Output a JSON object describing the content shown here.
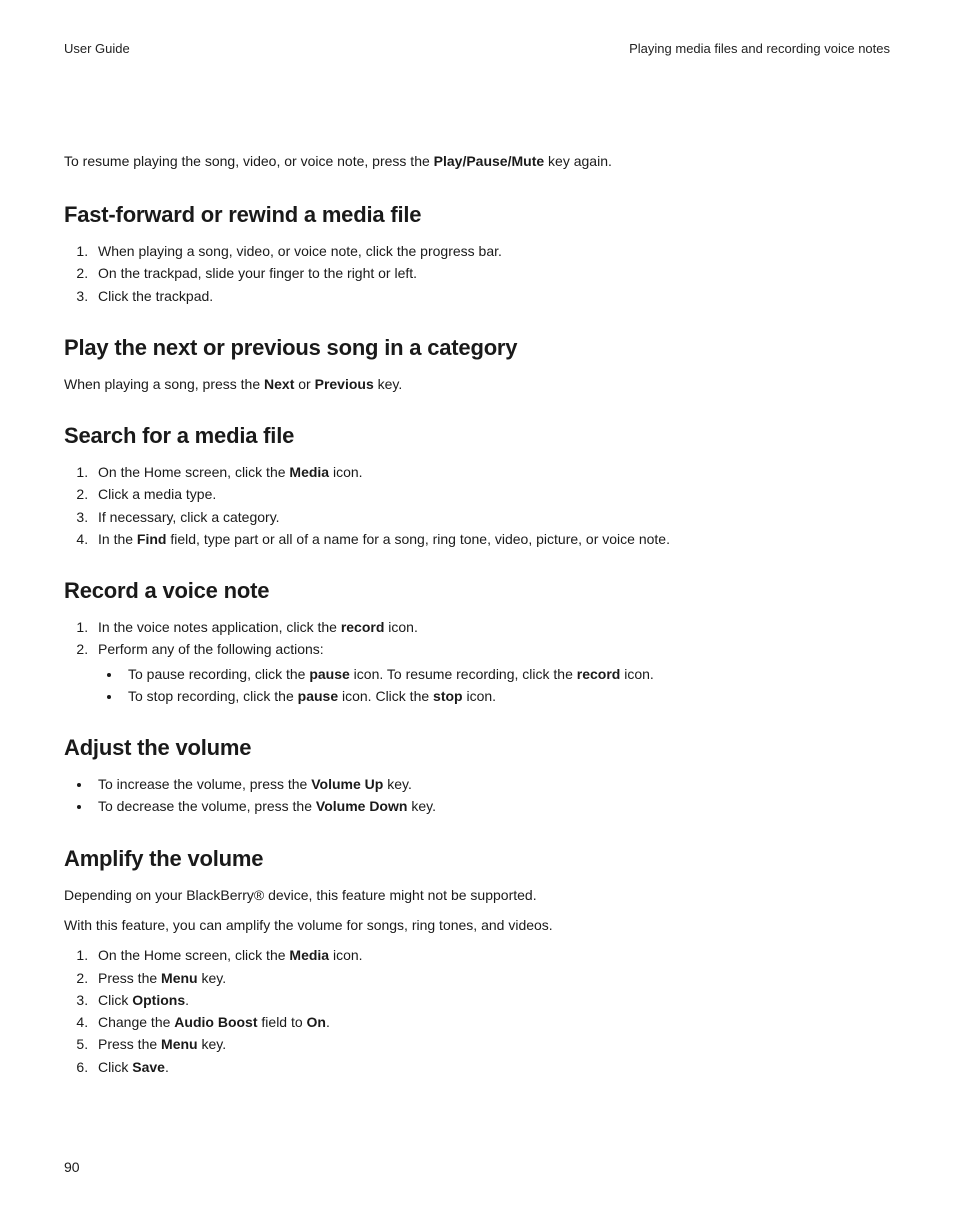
{
  "header": {
    "left": "User Guide",
    "right": "Playing media files and recording voice notes"
  },
  "intro": {
    "pre": "To resume playing the song, video, or voice note, press the ",
    "bold": "Play/Pause/Mute",
    "post": " key again."
  },
  "sec1": {
    "title": "Fast-forward or rewind a media file",
    "i1": "When playing a song, video, or voice note, click the progress bar.",
    "i2": "On the trackpad, slide your finger to the right or left.",
    "i3": "Click the trackpad."
  },
  "sec2": {
    "title": "Play the next or previous song in a category",
    "p_pre": "When playing a song, press the ",
    "b1": "Next",
    "p_mid": " or ",
    "b2": "Previous",
    "p_post": " key."
  },
  "sec3": {
    "title": "Search for a media file",
    "i1_pre": "On the Home screen, click the ",
    "i1_b": "Media",
    "i1_post": " icon.",
    "i2": "Click a media type.",
    "i3": "If necessary, click a category.",
    "i4_pre": "In the ",
    "i4_b": "Find",
    "i4_post": " field, type part or all of a name for a song, ring tone, video, picture, or voice note."
  },
  "sec4": {
    "title": "Record a voice note",
    "i1_pre": "In the voice notes application, click the ",
    "i1_b": "record",
    "i1_post": " icon.",
    "i2": "Perform any of the following actions:",
    "s1_pre": "To pause recording, click the ",
    "s1_b1": "pause",
    "s1_mid": " icon. To resume recording, click the ",
    "s1_b2": "record",
    "s1_post": " icon.",
    "s2_pre": "To stop recording, click the ",
    "s2_b1": "pause",
    "s2_mid": " icon. Click the ",
    "s2_b2": "stop",
    "s2_post": " icon."
  },
  "sec5": {
    "title": "Adjust the volume",
    "l1_pre": "To increase the volume, press the ",
    "l1_b": "Volume Up",
    "l1_post": " key.",
    "l2_pre": "To decrease the volume, press the ",
    "l2_b": "Volume Down",
    "l2_post": " key."
  },
  "sec6": {
    "title": "Amplify the volume",
    "p1": "Depending on your BlackBerry® device, this feature might not be supported.",
    "p2": "With this feature, you can amplify the volume for songs, ring tones, and videos.",
    "i1_pre": "On the Home screen, click the ",
    "i1_b": "Media",
    "i1_post": " icon.",
    "i2_pre": "Press the ",
    "i2_b": "Menu",
    "i2_post": " key.",
    "i3_pre": "Click ",
    "i3_b": "Options",
    "i3_post": ".",
    "i4_pre": "Change the ",
    "i4_b1": "Audio Boost",
    "i4_mid": " field to ",
    "i4_b2": "On",
    "i4_post": ".",
    "i5_pre": "Press the ",
    "i5_b": "Menu",
    "i5_post": " key.",
    "i6_pre": "Click ",
    "i6_b": "Save",
    "i6_post": "."
  },
  "page_number": "90"
}
